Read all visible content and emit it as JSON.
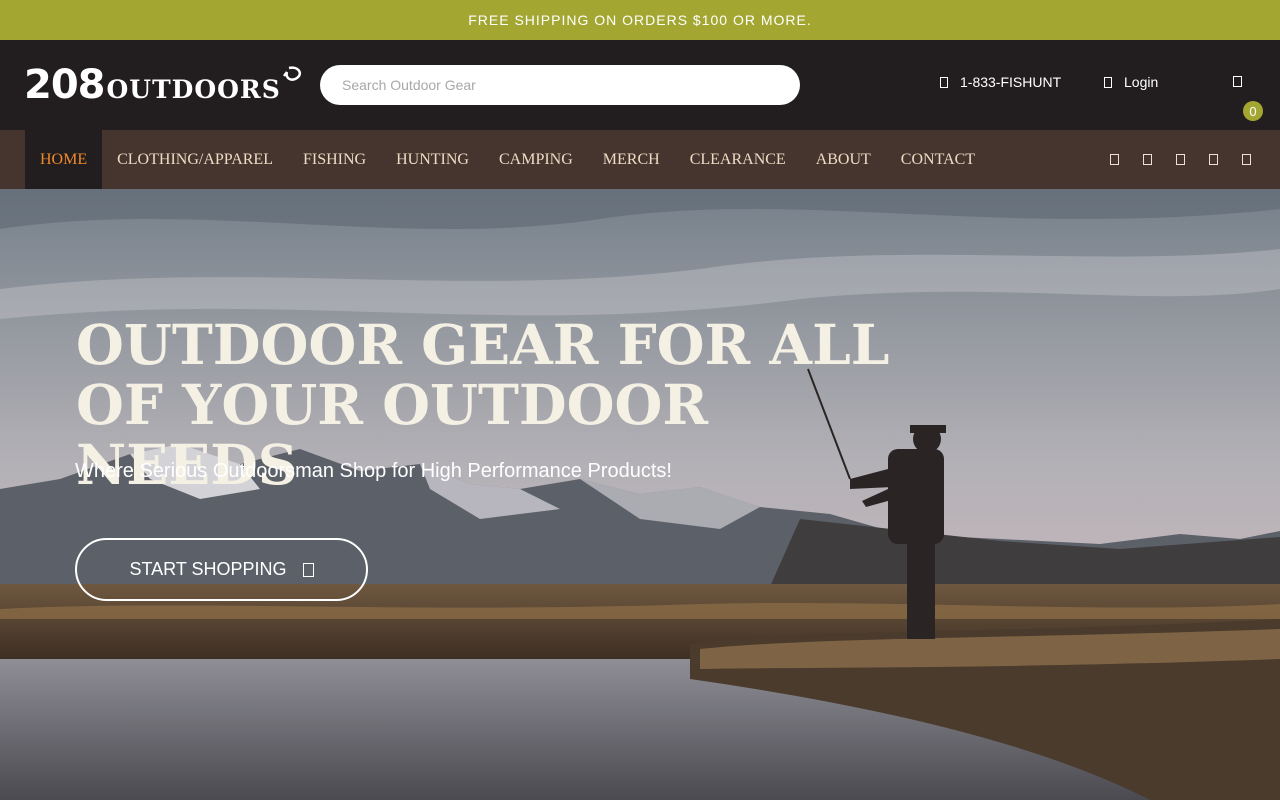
{
  "promo": {
    "text": "FREE SHIPPING ON ORDERS $100 OR MORE."
  },
  "brand": {
    "logo_number": "208",
    "logo_word": "OUTDOORS"
  },
  "search": {
    "placeholder": "Search Outdoor Gear",
    "value": ""
  },
  "header": {
    "phone": "1-833-FISHUNT",
    "login": "Login",
    "cart_count": "0"
  },
  "nav": {
    "items": [
      {
        "label": "HOME",
        "active": true
      },
      {
        "label": "CLOTHING/APPAREL"
      },
      {
        "label": "FISHING"
      },
      {
        "label": "HUNTING"
      },
      {
        "label": "CAMPING"
      },
      {
        "label": "MERCH"
      },
      {
        "label": "CLEARANCE"
      },
      {
        "label": "ABOUT"
      },
      {
        "label": "CONTACT"
      }
    ],
    "social_icons": [
      "social-icon",
      "social-icon",
      "social-icon",
      "social-icon",
      "social-icon"
    ]
  },
  "hero": {
    "title_line1": "OUTDOOR GEAR FOR ALL",
    "title_line2": "OF YOUR OUTDOOR NEEDS",
    "subtitle": "Where Serious Outdoorsman Shop for High Performance Products!",
    "cta_label": "START SHOPPING"
  },
  "colors": {
    "promo_bg": "#a3a732",
    "header_bg": "#221e1f",
    "nav_bg": "#45352e",
    "nav_active": "#f08a2b",
    "nav_text": "#ecdcc4"
  }
}
